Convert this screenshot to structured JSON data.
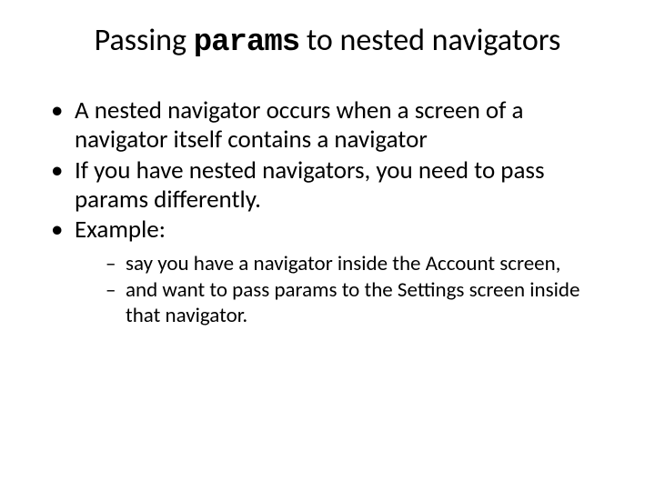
{
  "title_pre": "Passing ",
  "title_mono": "params",
  "title_post": " to nested navigators",
  "bullets": [
    "A nested navigator occurs when a screen of a navigator itself contains a navigator",
    "If you have nested navigators, you need to pass params differently.",
    "Example:"
  ],
  "sub_bullets": [
    " say you have a navigator inside the Account screen,",
    "and want to pass params to the Settings screen inside that navigator."
  ]
}
